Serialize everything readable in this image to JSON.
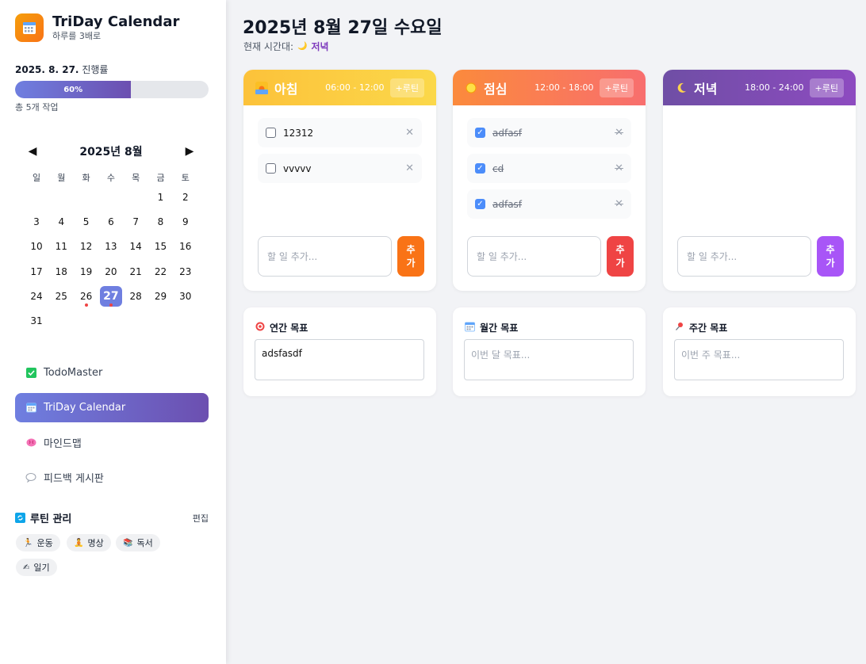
{
  "brand": {
    "title": "TriDay Calendar",
    "subtitle": "하루를 3배로"
  },
  "progress": {
    "date": "2025. 8. 27.",
    "label": "진행률",
    "percent_text": "60%",
    "percent": 60,
    "total": "총 5개 작업"
  },
  "calendar": {
    "title": "2025년 8월",
    "prev": "◀",
    "next": "▶",
    "weekdays": [
      "일",
      "월",
      "화",
      "수",
      "목",
      "금",
      "토"
    ],
    "days": [
      "1",
      "2",
      "3",
      "4",
      "5",
      "6",
      "7",
      "8",
      "9",
      "10",
      "11",
      "12",
      "13",
      "14",
      "15",
      "16",
      "17",
      "18",
      "19",
      "20",
      "21",
      "22",
      "23",
      "24",
      "25",
      "26",
      "27",
      "28",
      "29",
      "30",
      "31"
    ],
    "today": "27",
    "marked": [
      "26",
      "27"
    ]
  },
  "nav": [
    {
      "label": "TodoMaster",
      "icon": "check-square-icon",
      "active": false
    },
    {
      "label": "TriDay Calendar",
      "icon": "calendar-icon",
      "active": true
    },
    {
      "label": "마인드맵",
      "icon": "brain-icon",
      "active": false
    },
    {
      "label": "피드백 게시판",
      "icon": "speech-bubble-icon",
      "active": false
    }
  ],
  "routines": {
    "title": "루틴 관리",
    "edit": "편집",
    "items": [
      {
        "label": "운동",
        "icon": "🏃"
      },
      {
        "label": "명상",
        "icon": "🧘"
      },
      {
        "label": "독서",
        "icon": "📚"
      },
      {
        "label": "일기",
        "icon": "✍"
      }
    ]
  },
  "main": {
    "date_title": "2025년 8월 27일 수요일",
    "timezone_label": "현재 시간대:",
    "timezone_value": "저녁"
  },
  "slots": [
    {
      "name": "아침",
      "time": "06:00 - 12:00",
      "routine_btn": "+루틴",
      "icon": "sunrise-icon",
      "color_from": "#fcc23a",
      "color_to": "#fbd84a",
      "button_color": "#f97316",
      "tasks": [
        {
          "text": "12312",
          "done": false
        },
        {
          "text": "vvvvv",
          "done": false
        }
      ],
      "placeholder": "할 일 추가...",
      "add_label": [
        "추",
        "가"
      ]
    },
    {
      "name": "점심",
      "time": "12:00 - 18:00",
      "routine_btn": "+루틴",
      "icon": "sun-icon",
      "color_from": "#fb8a3c",
      "color_to": "#f86e6e",
      "button_color": "#ef4444",
      "tasks": [
        {
          "text": "adfasf",
          "done": true
        },
        {
          "text": "cd",
          "done": true
        },
        {
          "text": "adfasf",
          "done": true
        }
      ],
      "placeholder": "할 일 추가...",
      "add_label": [
        "추",
        "가"
      ]
    },
    {
      "name": "저녁",
      "time": "18:00 - 24:00",
      "routine_btn": "+루틴",
      "icon": "moon-icon",
      "color_from": "#6f4ea5",
      "color_to": "#8d4bc0",
      "button_color": "#a855f7",
      "tasks": [],
      "placeholder": "할 일 추가...",
      "add_label": [
        "추",
        "가"
      ]
    }
  ],
  "goals": [
    {
      "title": "연간 목표",
      "icon": "target-icon",
      "value": "adsfasdf",
      "placeholder": ""
    },
    {
      "title": "월간 목표",
      "icon": "calendar-icon",
      "value": "",
      "placeholder": "이번 달 목표..."
    },
    {
      "title": "주간 목표",
      "icon": "pin-icon",
      "value": "",
      "placeholder": "이번 주 목표..."
    }
  ]
}
